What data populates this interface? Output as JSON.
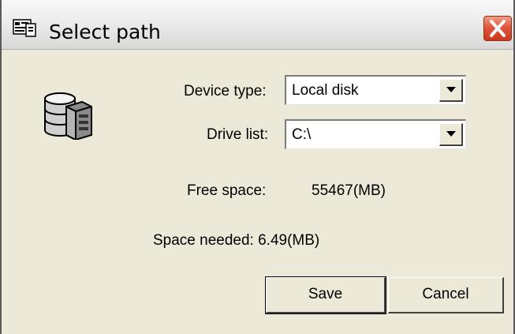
{
  "window": {
    "title": "Select path",
    "close_icon": "close-icon"
  },
  "form": {
    "device_type_label": "Device type:",
    "device_type_value": "Local disk",
    "drive_list_label": "Drive list:",
    "drive_list_value": "C:\\",
    "free_space_label": "Free space:",
    "free_space_value": "55467(MB)",
    "space_needed": "Space needed: 6.49(MB)"
  },
  "buttons": {
    "save_label": "Save",
    "cancel_label": "Cancel"
  },
  "icons": {
    "title_icon": "setup-icon",
    "device_icon": "database-disk-icon",
    "dropdown_icon": "chevron-down-icon"
  },
  "colors": {
    "dialog_background": "#ece9d8",
    "close_button": "#e0573b"
  }
}
